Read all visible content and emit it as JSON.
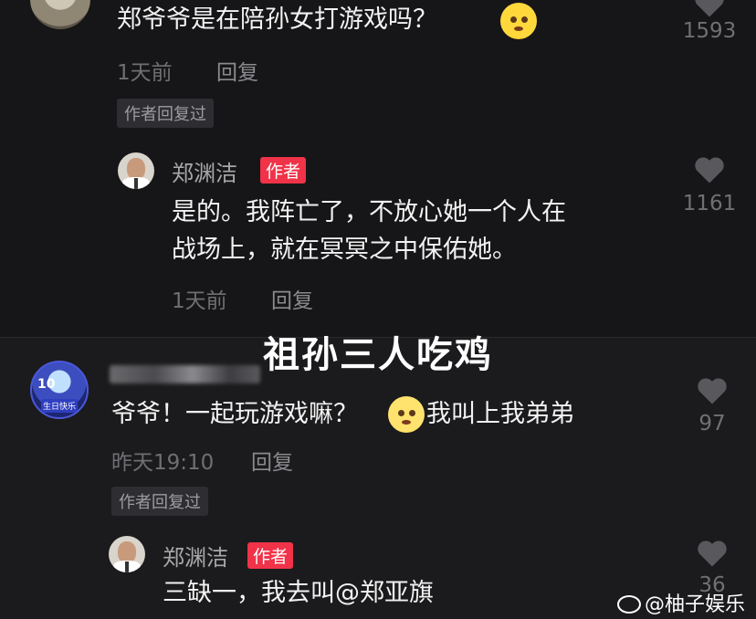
{
  "overlay_title": "祖孙三人吃鸡",
  "watermark": "@柚子娱乐",
  "comments": [
    {
      "text": "郑爷爷是在陪孙女打游戏吗？",
      "time": "1天前",
      "reply": "回复",
      "author_replied": "作者回复过",
      "likes": "1593",
      "emoji": "angry-face"
    },
    {
      "username": "郑渊洁",
      "author_tag": "作者",
      "text_line1": "是的。我阵亡了，不放心她一个人在",
      "text_line2": "战场上，就在冥冥之中保佑她。",
      "time": "1天前",
      "reply": "回复",
      "likes": "1161"
    },
    {
      "text": "爷爷！一起玩游戏嘛？",
      "text_after_emoji": "我叫上我弟弟",
      "time": "昨天19:10",
      "reply": "回复",
      "author_replied": "作者回复过",
      "likes": "97",
      "emoji": "pleading-face",
      "avatar_text_1": "10",
      "avatar_text_2": "生日快乐"
    },
    {
      "username": "郑渊洁",
      "author_tag": "作者",
      "text": "三缺一，我去叫@郑亚旗",
      "likes": "36"
    }
  ],
  "colors": {
    "author_tag": "#f03348",
    "background": "#141416"
  }
}
